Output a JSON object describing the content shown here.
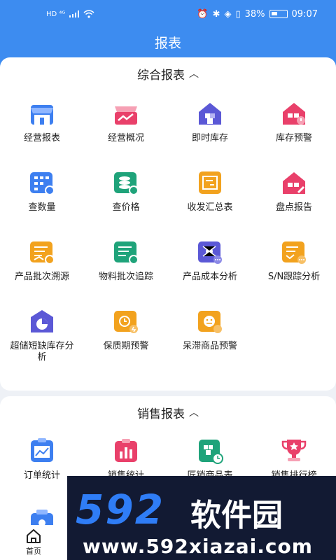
{
  "status_bar": {
    "left": "HD ⁴ᴳ",
    "battery": "38%",
    "time": "09:07"
  },
  "title": "报表",
  "section1": {
    "header": "综合报表",
    "items": [
      {
        "label": "经营报表",
        "icon": "store-icon",
        "color": "#3d7ff0"
      },
      {
        "label": "经营概况",
        "icon": "shop-trend-icon",
        "color": "#e9406a"
      },
      {
        "label": "即时库存",
        "icon": "warehouse-boxes-icon",
        "color": "#5b58d6"
      },
      {
        "label": "库存预警",
        "icon": "warehouse-alert-icon",
        "color": "#e9406a"
      },
      {
        "label": "查数量",
        "icon": "grid-search-icon",
        "color": "#3d7ff0"
      },
      {
        "label": "查价格",
        "icon": "price-search-icon",
        "color": "#1fa37a"
      },
      {
        "label": "收发汇总表",
        "icon": "transfer-summary-icon",
        "color": "#f2a21e"
      },
      {
        "label": "盘点报告",
        "icon": "warehouse-edit-icon",
        "color": "#e9406a"
      },
      {
        "label": "产品批次溯源",
        "icon": "batch-trace-icon",
        "color": "#f2a21e"
      },
      {
        "label": "物料批次追踪",
        "icon": "material-trace-icon",
        "color": "#1fa37a"
      },
      {
        "label": "产品成本分析",
        "icon": "cost-analysis-icon",
        "color": "#5b58d6"
      },
      {
        "label": "S/N跟踪分析",
        "icon": "sn-tracking-icon",
        "color": "#f2a21e"
      },
      {
        "label": "超储短缺库存分析",
        "icon": "pie-analysis-icon",
        "color": "#5b58d6"
      },
      {
        "label": "保质期预警",
        "icon": "clock-alert-icon",
        "color": "#f2a21e"
      },
      {
        "label": "呆滞商品预警",
        "icon": "face-alert-icon",
        "color": "#f2a21e"
      }
    ]
  },
  "section2": {
    "header": "销售报表",
    "items": [
      {
        "label": "订单统计",
        "icon": "order-chart-icon",
        "color": "#3d7ff0"
      },
      {
        "label": "销售统计",
        "icon": "sales-bar-icon",
        "color": "#e9406a"
      },
      {
        "label": "匠销商品表",
        "icon": "product-clock-icon",
        "color": "#1fa37a"
      },
      {
        "label": "销售排行榜",
        "icon": "trophy-icon",
        "color": "#e9406a"
      },
      {
        "label": "",
        "icon": "money-bag-icon",
        "color": "#3d7ff0"
      }
    ]
  },
  "bottom_nav": {
    "home_label": "首页"
  },
  "watermark": {
    "logo_num": "592",
    "logo_cn": "软件园",
    "url": "www.592xiazai.com"
  }
}
